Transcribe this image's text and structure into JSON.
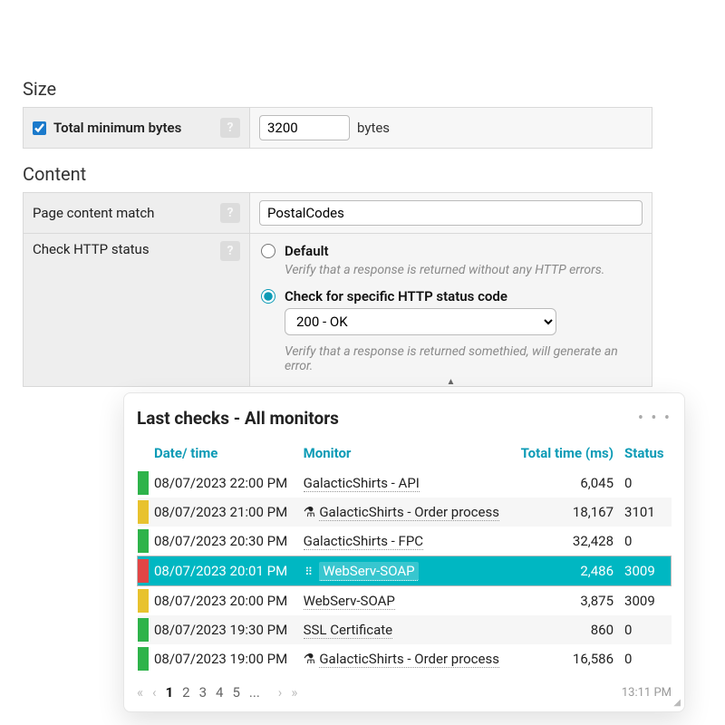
{
  "size": {
    "section": "Size",
    "min_bytes_label": "Total minimum bytes",
    "min_bytes_checked": true,
    "value": "3200",
    "unit": "bytes"
  },
  "content": {
    "section": "Content",
    "match_label": "Page content match",
    "match_value": "PostalCodes",
    "http_label": "Check HTTP status",
    "opt_default": "Default",
    "opt_default_desc": "Verify that a response is returned without any HTTP errors.",
    "opt_specific": "Check for specific HTTP status code",
    "selected_code": "200 - OK",
    "specific_desc": "Verify that a response is returned somethied, will generate an error."
  },
  "checks": {
    "title": "Last checks - All monitors",
    "cols": {
      "dt": "Date/ time",
      "mon": "Monitor",
      "total": "Total time (ms)",
      "status": "Status"
    },
    "rows": [
      {
        "color": "green",
        "dt": "08/07/2023 22:00 PM",
        "mon": "GalacticShirts - API",
        "icon": "",
        "total": "6,045",
        "status": "0",
        "sel": false
      },
      {
        "color": "yellow",
        "dt": "08/07/2023 21:00 PM",
        "mon": "GalacticShirts - Order process",
        "icon": "flask",
        "total": "18,167",
        "status": "3101",
        "sel": false
      },
      {
        "color": "green",
        "dt": "08/07/2023 20:30 PM",
        "mon": "GalacticShirts - FPC",
        "icon": "",
        "total": "32,428",
        "status": "0",
        "sel": false
      },
      {
        "color": "red",
        "dt": "08/07/2023 20:01 PM",
        "mon": "WebServ-SOAP",
        "icon": "grip",
        "total": "2,486",
        "status": "3009",
        "sel": true
      },
      {
        "color": "yellow",
        "dt": "08/07/2023 20:00 PM",
        "mon": "WebServ-SOAP",
        "icon": "",
        "total": "3,875",
        "status": "3009",
        "sel": false
      },
      {
        "color": "green",
        "dt": "08/07/2023 19:30 PM",
        "mon": "SSL Certificate",
        "icon": "",
        "total": "860",
        "status": "0",
        "sel": false
      },
      {
        "color": "green",
        "dt": "08/07/2023 19:00 PM",
        "mon": "GalacticShirts - Order process",
        "icon": "flask",
        "total": "16,586",
        "status": "0",
        "sel": false
      }
    ],
    "pages": [
      "1",
      "2",
      "3",
      "4",
      "5",
      "..."
    ],
    "time": "13:11 PM"
  },
  "glyphs": {
    "help": "?",
    "flask": "⚗",
    "grip": "⠿",
    "first": "«",
    "prev": "‹",
    "next": "›",
    "last": "»",
    "kebab": "• • •",
    "caret": "▲",
    "resize": "◢"
  }
}
